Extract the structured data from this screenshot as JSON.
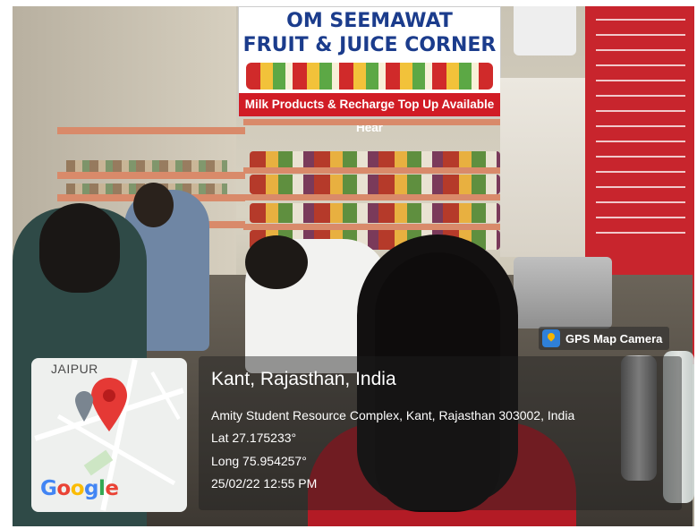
{
  "sign": {
    "line1": "OM SEEMAWAT",
    "line2": "FRUIT & JUICE CORNER",
    "band": "Milk Products & Recharge Top  Up Available Hear"
  },
  "gps": {
    "app_label": "GPS Map Camera",
    "place": "Kant, Rajasthan, India",
    "address": "Amity Student Resource Complex, Kant, Rajasthan 303002, India",
    "lat": "Lat 27.175233°",
    "long": "Long 75.954257°",
    "datetime": "25/02/22 12:55 PM"
  },
  "map": {
    "city": "JAIPUR",
    "brand": "Google"
  },
  "colors": {
    "sign_blue": "#1b3c8c",
    "sign_red": "#d11c25",
    "pin_red": "#e53935"
  }
}
